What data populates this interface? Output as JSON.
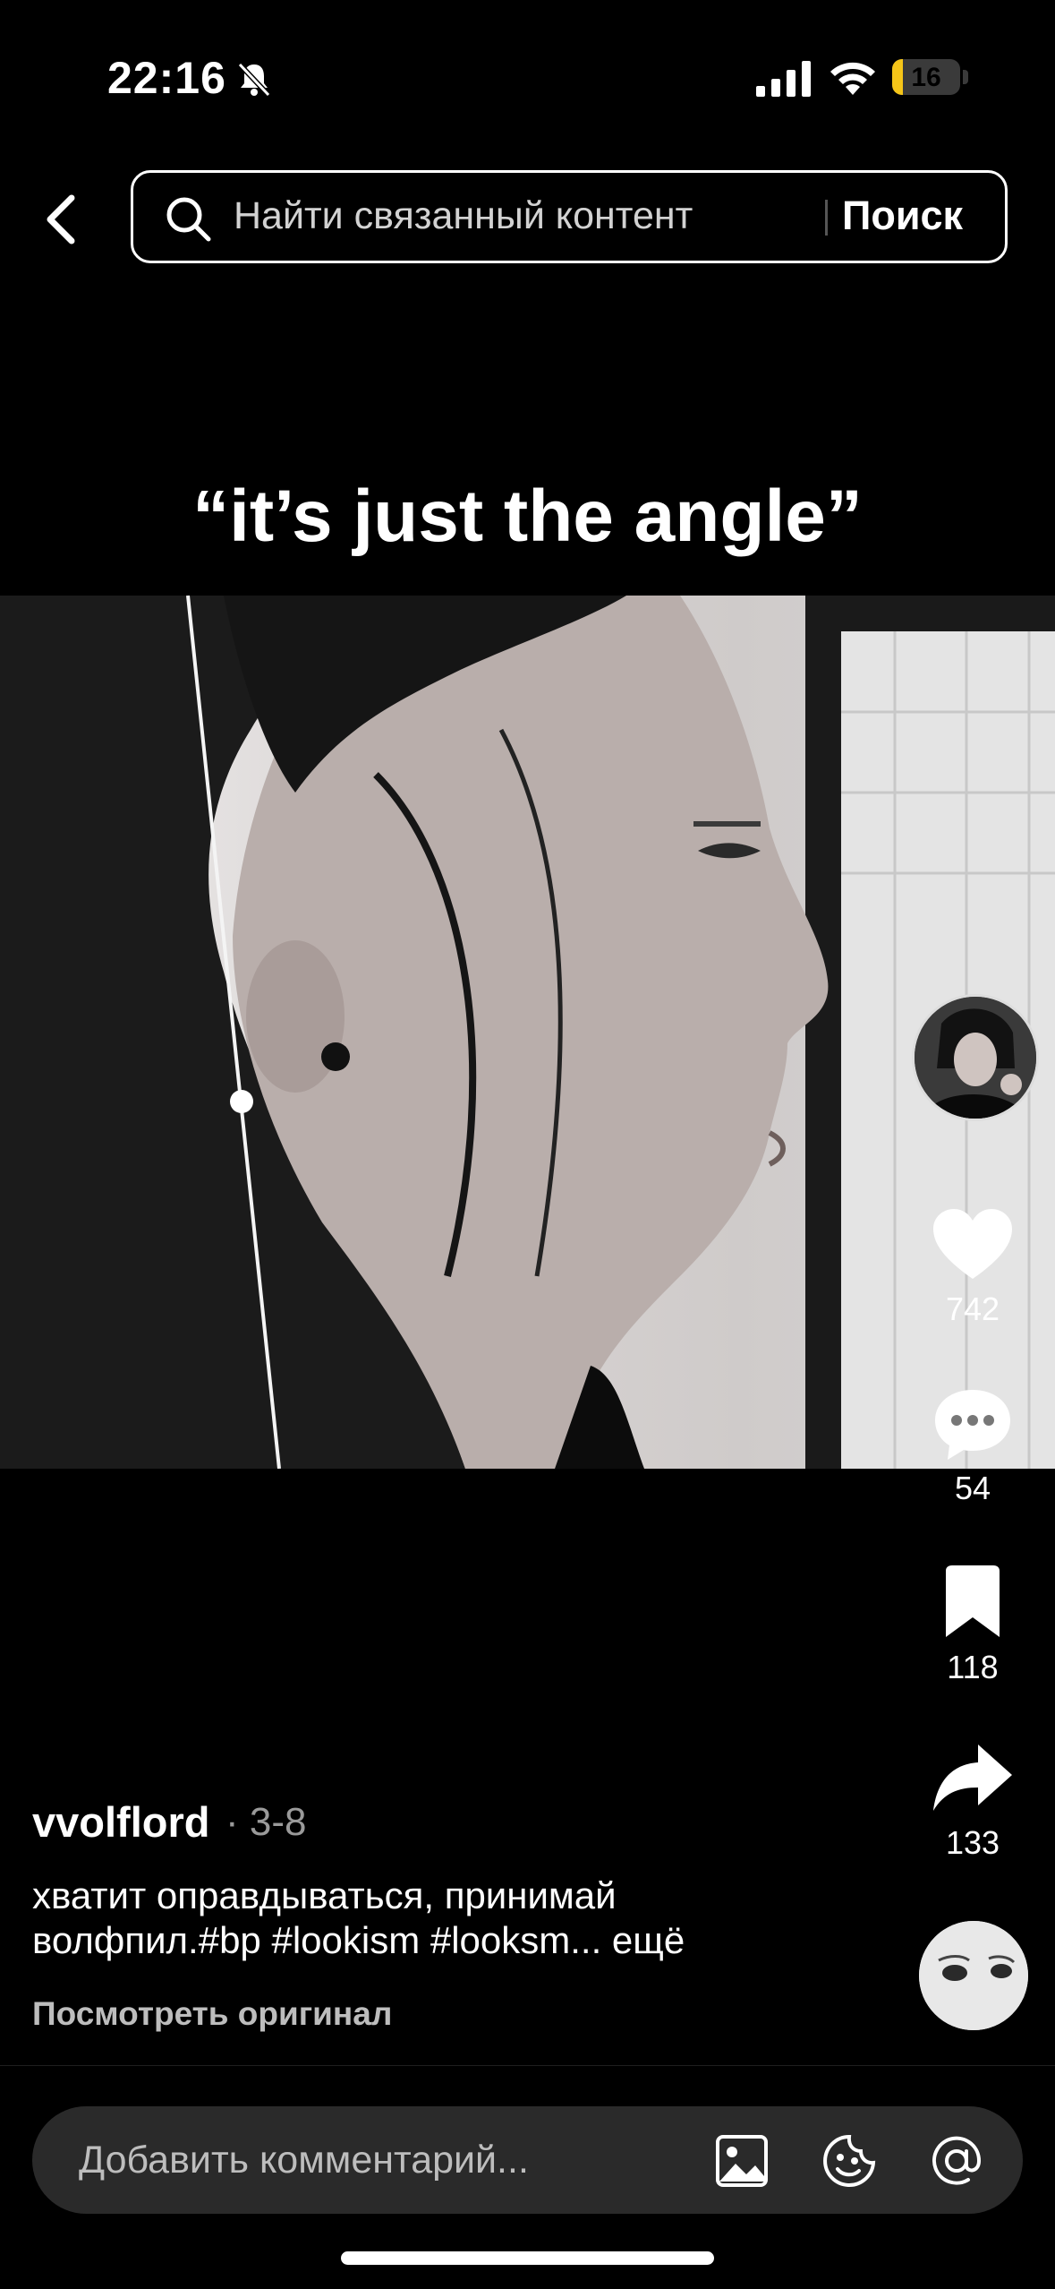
{
  "status_bar": {
    "time": "22:16",
    "battery_level": "16",
    "battery_color": "#f5c518"
  },
  "header": {
    "back_icon": "chevron-left-icon",
    "search_placeholder": "Найти связанный контент",
    "search_button": "Поиск"
  },
  "video": {
    "caption": "“it’s just the angle”"
  },
  "actions": {
    "likes": "742",
    "comments": "54",
    "saves": "118",
    "shares": "133"
  },
  "post": {
    "author": "vvolflord",
    "date": "· 3-8",
    "description": "хватит оправдываться, принимай волфпил.#bp #lookism #looksm... ещё",
    "view_original": "Посмотреть оригинал"
  },
  "comment_bar": {
    "placeholder": "Добавить комментарий...",
    "icons": [
      "image-icon",
      "emoji-icon",
      "mention-icon"
    ]
  }
}
